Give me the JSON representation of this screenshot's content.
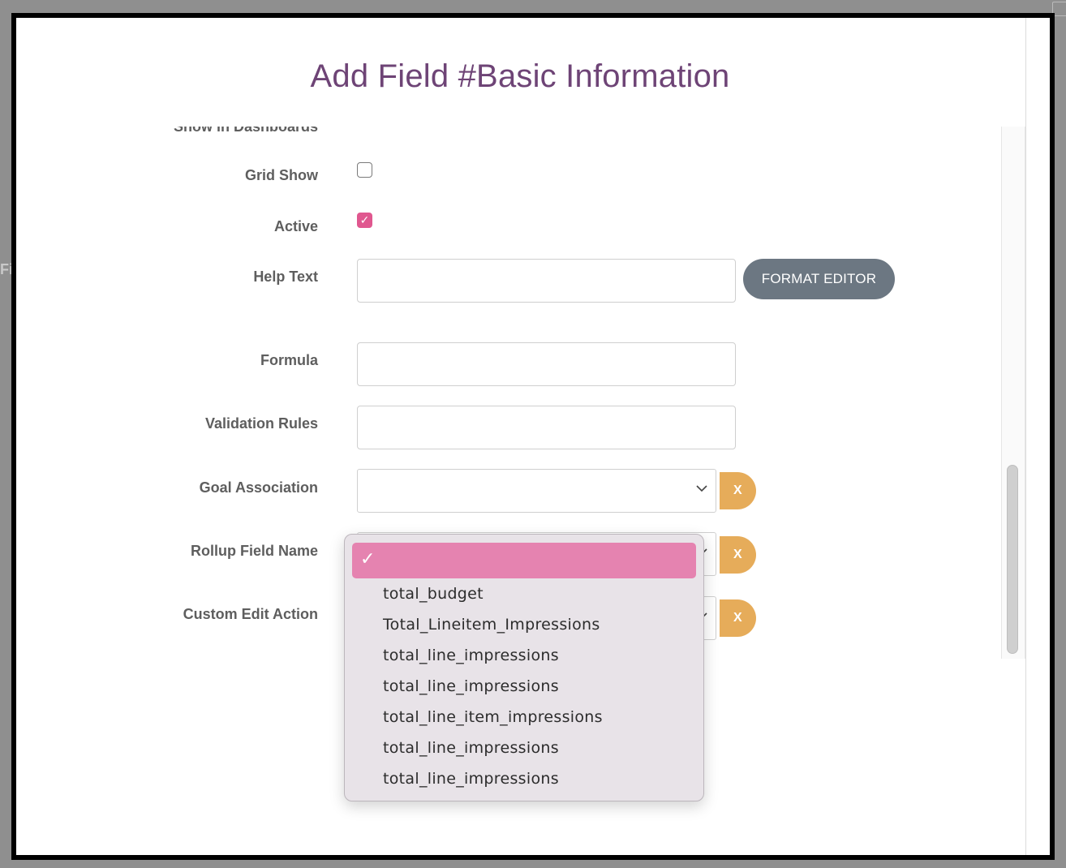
{
  "modal": {
    "title": "Add Field #Basic Information"
  },
  "form": {
    "show_in_dashboards_label": "Show in Dashboards",
    "grid_show_label": "Grid Show",
    "grid_show_checked": false,
    "active_label": "Active",
    "active_checked": true,
    "help_text_label": "Help Text",
    "help_text_value": "",
    "format_editor_label": "FORMAT EDITOR",
    "formula_label": "Formula",
    "formula_value": "",
    "validation_rules_label": "Validation Rules",
    "validation_rules_value": "",
    "goal_association_label": "Goal Association",
    "goal_association_value": "",
    "rollup_field_name_label": "Rollup Field Name",
    "custom_edit_action_label": "Custom Edit Action",
    "clear_label": "X"
  },
  "dropdown": {
    "selected_check": "✓",
    "selected_value": "",
    "options": [
      "total_budget",
      "Total_Lineitem_Impressions",
      "total_line_impressions",
      "total_line_impressions",
      "total_line_item_impressions",
      "total_line_impressions",
      "total_line_impressions"
    ]
  },
  "colors": {
    "title": "#6e4476",
    "checkbox_active": "#e0578f",
    "clear_button": "#e6ac5a",
    "format_editor_button": "#6c7782",
    "dropdown_selected": "#e583b0",
    "dropdown_bg": "#e8e3e8"
  },
  "icons": {
    "select_arrow": "chevron-down-icon",
    "checkmark": "check-icon"
  }
}
